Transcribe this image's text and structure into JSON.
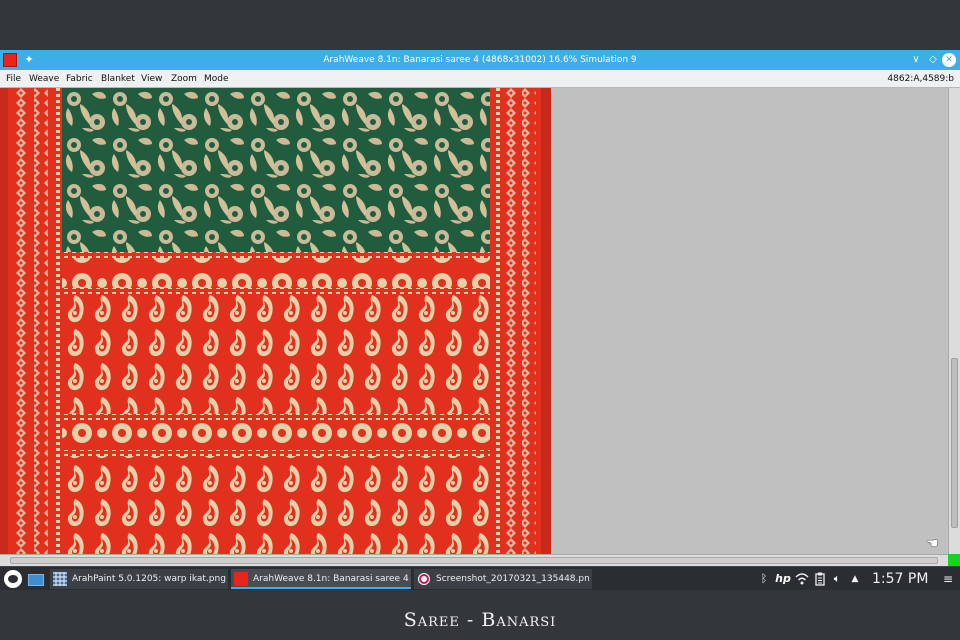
{
  "window": {
    "title": "ArahWeave 8.1n: Banarasi saree 4 (4868x31002) 16.6% Simulation 9",
    "controls": [
      "minimize",
      "restore",
      "close"
    ]
  },
  "menu": {
    "items": [
      "File",
      "Weave",
      "Fabric",
      "Blanket",
      "View",
      "Zoom",
      "Mode"
    ],
    "coords": "4862:A,4589:b"
  },
  "colors": {
    "titlebar": "#3daee9",
    "saree_red": "#e1301d",
    "saree_green": "#215c3e",
    "motif_cream": "#dcc6a3",
    "canvas_bg": "#c0c0c0"
  },
  "taskbar": {
    "tasks": [
      {
        "label": "ArahPaint 5.0.1205: warp ikat.png ...",
        "icon": "arahpaint-icon"
      },
      {
        "label": "ArahWeave 8.1n: Banarasi saree 4 ...",
        "icon": "arahweave-icon"
      },
      {
        "label": "Screenshot_20170321_135448.pn...",
        "icon": "screenshot-icon"
      }
    ],
    "tray": [
      "bluetooth-icon",
      "hp-icon",
      "wifi-icon",
      "clipboard-icon",
      "volume-icon",
      "expand-tray-icon"
    ],
    "clock": "1:57 PM"
  },
  "caption": "Saree - Banarsi"
}
